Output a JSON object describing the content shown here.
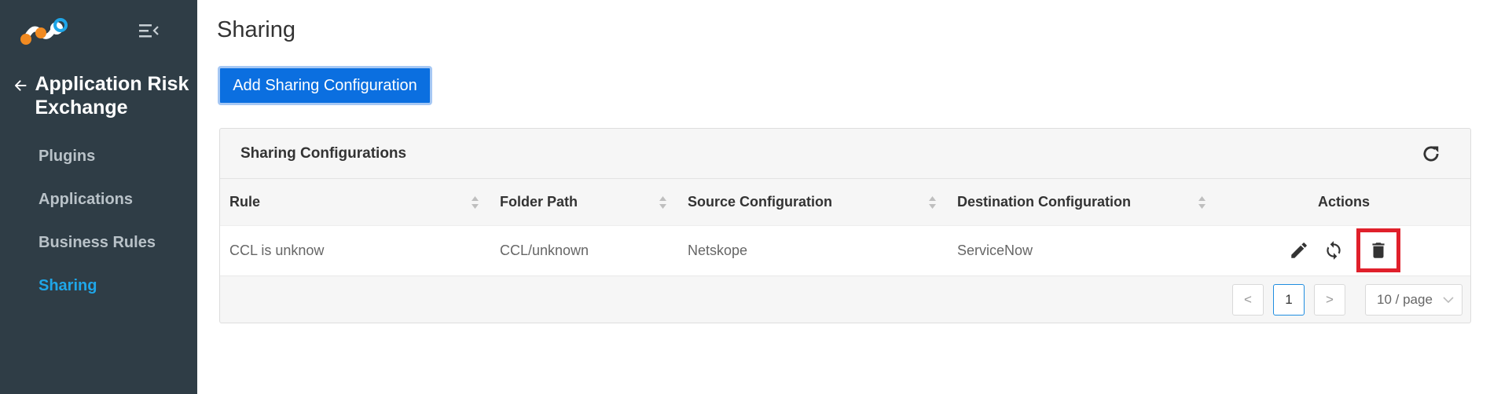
{
  "sidebar": {
    "module_title": "Application Risk Exchange",
    "nav": [
      {
        "label": "Plugins"
      },
      {
        "label": "Applications"
      },
      {
        "label": "Business Rules"
      },
      {
        "label": "Sharing"
      }
    ],
    "active_index": 3
  },
  "main": {
    "page_title": "Sharing",
    "add_button_label": "Add Sharing Configuration",
    "panel_title": "Sharing Configurations",
    "columns": [
      "Rule",
      "Folder Path",
      "Source Configuration",
      "Destination Configuration",
      "Actions"
    ],
    "rows": [
      {
        "rule": "CCL is unknow",
        "folder_path": "CCL/unknown",
        "source": "Netskope",
        "destination": "ServiceNow"
      }
    ],
    "pagination": {
      "prev": "<",
      "current_page": "1",
      "next": ">",
      "page_size": "10 / page"
    }
  },
  "icons": [
    "app-logo-icon",
    "menu-collapse-icon",
    "arrow-left-icon",
    "refresh-icon",
    "sort-icon",
    "edit-icon",
    "sync-icon",
    "trash-icon",
    "chevron-down-icon"
  ],
  "colors": {
    "sidebar_bg": "#2f3d46",
    "accent": "#1fa6e8",
    "primary_button": "#0b6fe0",
    "highlight": "#e0202b",
    "logo_orange": "#f18a21",
    "logo_blue": "#1fa6e8"
  }
}
